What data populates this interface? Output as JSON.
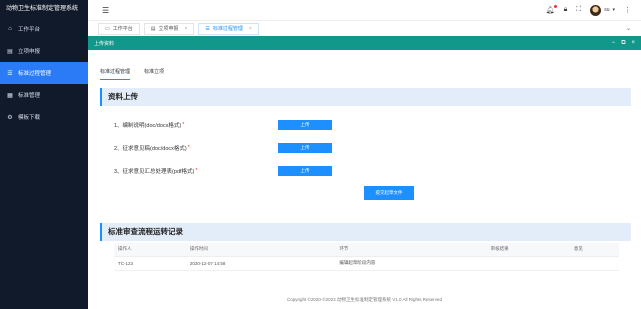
{
  "app": {
    "title": "动物卫生标准制定管理系统"
  },
  "sidebar": {
    "items": [
      {
        "label": "工作平台",
        "icon": "home-icon",
        "glyph": "⌂",
        "active": false
      },
      {
        "label": "立项申报",
        "icon": "file-icon",
        "glyph": "▤",
        "active": false
      },
      {
        "label": "标准过程管理",
        "icon": "list-icon",
        "glyph": "☰",
        "active": true
      },
      {
        "label": "标准管理",
        "icon": "grid-icon",
        "glyph": "▦",
        "active": false
      },
      {
        "label": "模板下载",
        "icon": "gear-icon",
        "glyph": "⚙",
        "active": false
      }
    ]
  },
  "header": {
    "username": "su"
  },
  "tabs": [
    {
      "label": "工作平台",
      "closable": false,
      "active": false
    },
    {
      "label": "立项申报",
      "closable": true,
      "active": false
    },
    {
      "label": "标准过程管理",
      "closable": true,
      "active": true
    }
  ],
  "panel": {
    "title": "上传资料",
    "subtabs": [
      "标准过程管理",
      "标准立项"
    ],
    "upload": {
      "title": "资料上传",
      "rows": [
        {
          "label": "1、编制说明(doc/docx格式)",
          "button": "上传"
        },
        {
          "label": "2、征求意见稿(doc/docx格式)",
          "button": "上传"
        },
        {
          "label": "3、征求意见汇总处理表(pdf格式)",
          "button": "上传"
        }
      ],
      "submit": "提交起草文件"
    },
    "records": {
      "title": "标准审查流程运转记录",
      "columns": [
        "操作人",
        "操作时间",
        "环节",
        "审核结果",
        "意见"
      ],
      "rows": [
        [
          "TC-123",
          "2020-12-07 14:58",
          "编辑起草阶段内容",
          "",
          ""
        ]
      ]
    }
  },
  "footer": {
    "text": "Copyright ©2020-©2022 动物卫生标准制定管理系统 V1.0 All Rights Reserved"
  },
  "colors": {
    "sidebar_bg": "#111a2a",
    "accent": "#1e8fff",
    "panel_header": "#12988b"
  }
}
